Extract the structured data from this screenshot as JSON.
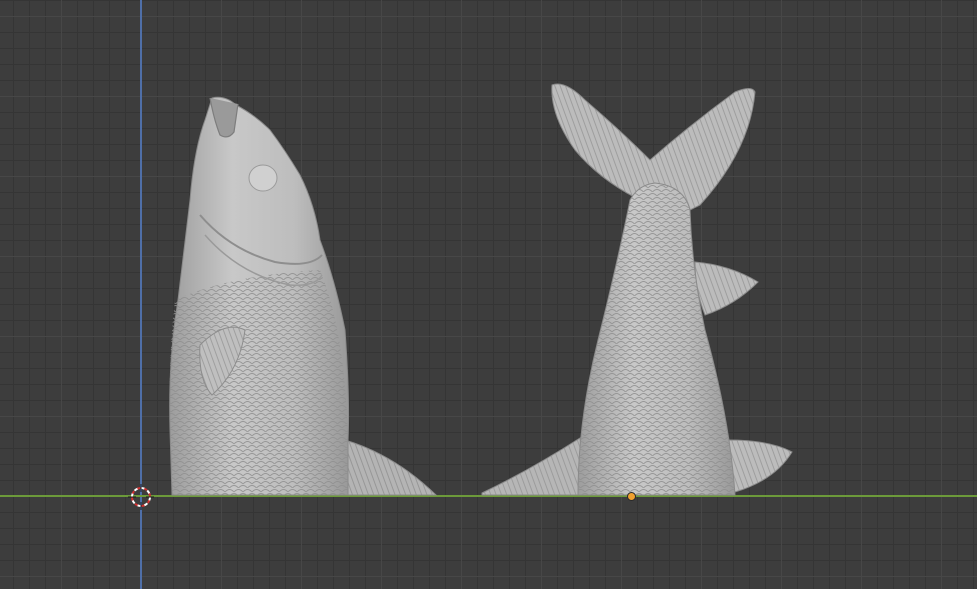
{
  "viewport": {
    "mode": "3d-viewport-orthographic-front",
    "background_color": "#3d3d3d",
    "grid_color": "#474747",
    "x_axis_color": "#6c9a3a",
    "z_axis_color": "#4f6fa8"
  },
  "objects": [
    {
      "name": "fish-head-up",
      "material_color": "#b9b9b9"
    },
    {
      "name": "fish-tail-up",
      "material_color": "#b9b9b9"
    }
  ],
  "markers": {
    "cursor_icon": "3d-cursor-icon",
    "origin_icon": "object-origin-icon",
    "origin_color": "#f0a030"
  }
}
